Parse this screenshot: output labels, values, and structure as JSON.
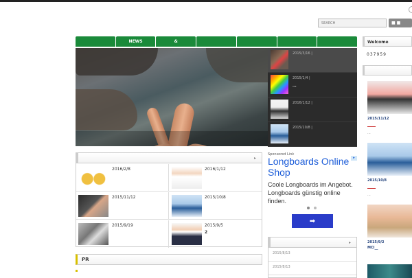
{
  "search": {
    "placeholder": "SEARCH"
  },
  "search_button": {
    "label": "■ ■"
  },
  "nav": [
    {
      "label": ""
    },
    {
      "label": "NEWS"
    },
    {
      "label": "&"
    },
    {
      "label": ""
    },
    {
      "label": ""
    },
    {
      "label": ""
    },
    {
      "label": ""
    }
  ],
  "slider": {
    "items": [
      {
        "date": "2015/3/16  |",
        "title": ""
      },
      {
        "date": "2015/1/4  |",
        "title": "..."
      },
      {
        "date": "2016/1/12  |",
        "title": ""
      },
      {
        "date": "2015/10/8  |",
        "title": ""
      }
    ]
  },
  "posts": {
    "cells": [
      {
        "date": "2016/2/8",
        "title": ""
      },
      {
        "date": "2016/1/12",
        "title": ""
      },
      {
        "date": "2015/11/12",
        "title": ""
      },
      {
        "date": "2015/10/8",
        "title": ""
      },
      {
        "date": "2015/9/19",
        "title": ""
      },
      {
        "date": "2015/9/5",
        "title": "2"
      }
    ]
  },
  "ad": {
    "label": "Sponsored Link",
    "title": "Longboards Online Shop",
    "body": "Coole Longboards im Angebot. Longboards günstig online finden.",
    "button": "➡",
    "corner": "▸"
  },
  "panel2": {
    "rows": [
      "2015/8/13",
      "2015/8/13"
    ]
  },
  "pr": {
    "label": "PR"
  },
  "sidebar": {
    "welcome": "Welcome",
    "counter": "037959",
    "cards": [
      {
        "date": "2015/11/12",
        "extra": "...",
        "title": ""
      },
      {
        "date": "2015/10/8",
        "extra": "...",
        "title": ""
      },
      {
        "date": "2015/9/2",
        "extra": "",
        "title": "MCI__"
      }
    ]
  }
}
